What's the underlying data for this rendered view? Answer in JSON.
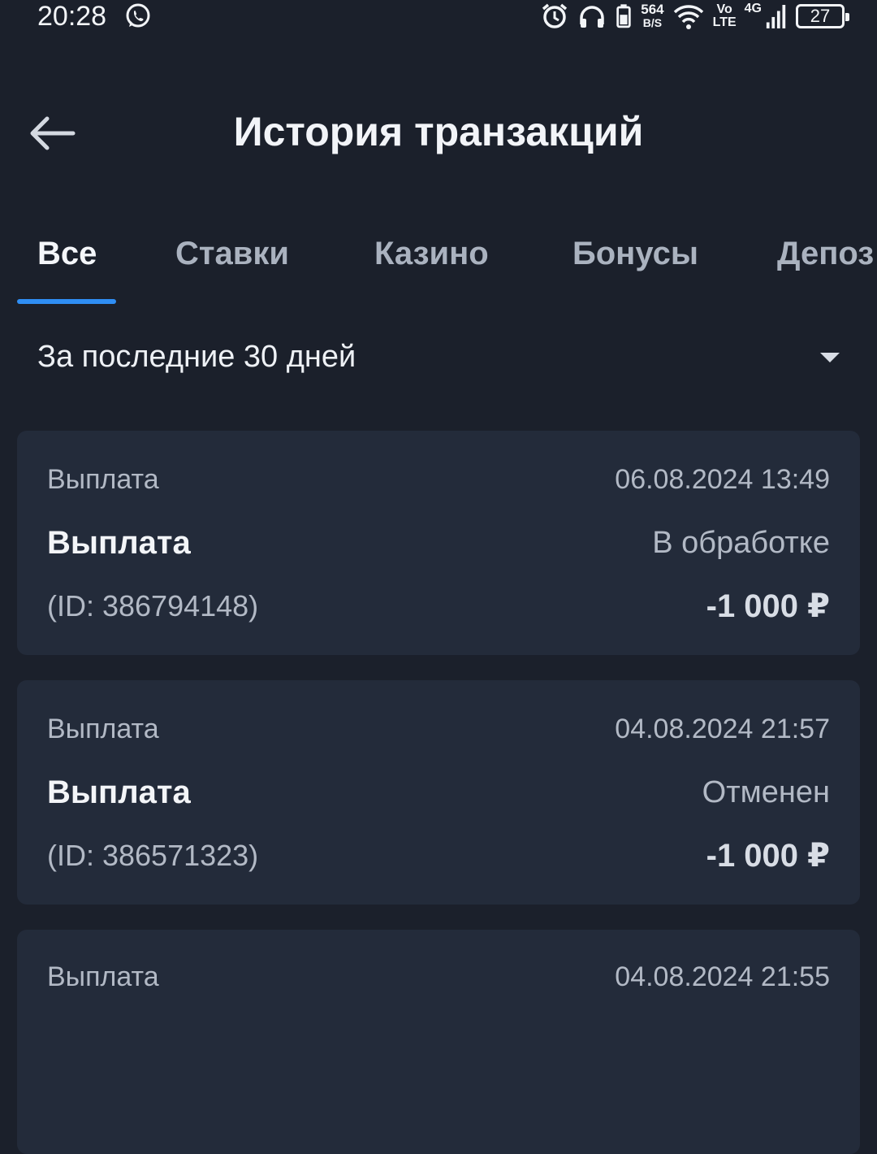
{
  "status_bar": {
    "time": "20:28",
    "speed_value": "564",
    "speed_unit": "B/S",
    "volte_top": "Vo",
    "volte_bottom": "LTE",
    "network": "4G",
    "battery": "27",
    "icons": [
      "whatsapp-icon",
      "alarm-icon",
      "headphones-icon",
      "phone-battery-icon",
      "wifi-icon",
      "signal-icon"
    ]
  },
  "header": {
    "title": "История транзакций",
    "back_icon": "arrow-left-icon"
  },
  "tabs": [
    {
      "label": "Все",
      "active": true
    },
    {
      "label": "Ставки",
      "active": false
    },
    {
      "label": "Казино",
      "active": false
    },
    {
      "label": "Бонусы",
      "active": false
    },
    {
      "label": "Депоз",
      "active": false
    }
  ],
  "filter": {
    "label": "За последние 30 дней",
    "icon": "chevron-down-icon"
  },
  "transactions": [
    {
      "type": "Выплата",
      "date": "06.08.2024 13:49",
      "name": "Выплата",
      "status": "В обработке",
      "id": "(ID: 386794148)",
      "amount": "-1 000 ₽"
    },
    {
      "type": "Выплата",
      "date": "04.08.2024 21:57",
      "name": "Выплата",
      "status": "Отменен",
      "id": "(ID: 386571323)",
      "amount": "-1 000 ₽"
    },
    {
      "type": "Выплата",
      "date": "04.08.2024 21:55",
      "name": "",
      "status": "",
      "id": "",
      "amount": ""
    }
  ],
  "colors": {
    "background": "#1b202b",
    "card": "#232b3a",
    "accent": "#2f8ef4",
    "muted_text": "#b2b9c5"
  }
}
